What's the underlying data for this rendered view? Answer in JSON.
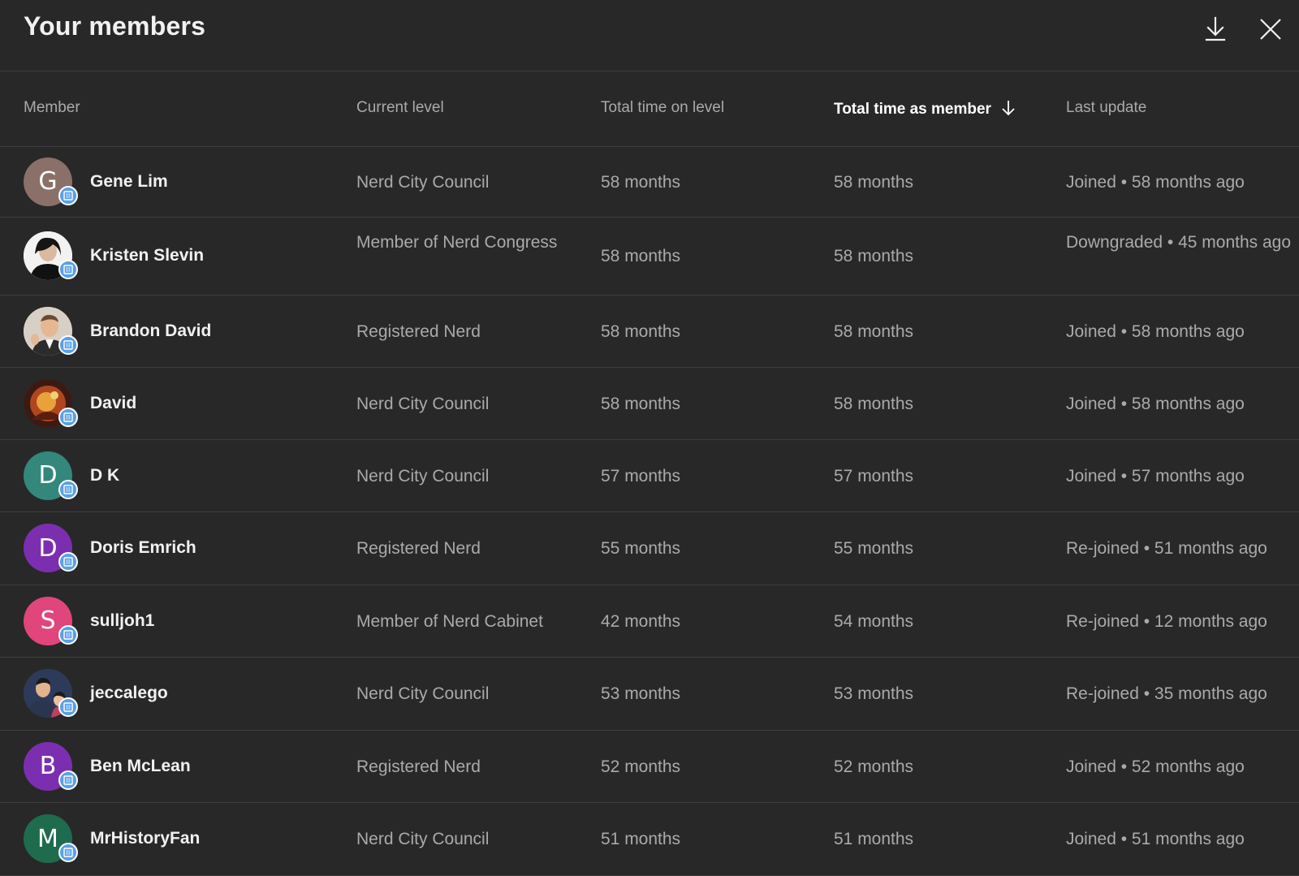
{
  "header": {
    "title": "Your members",
    "download_icon": "download-icon",
    "close_icon": "close-icon"
  },
  "columns": {
    "member": "Member",
    "current_level": "Current level",
    "time_on_level": "Total time on level",
    "time_as_member": "Total time as member",
    "last_update": "Last update",
    "sorted_by": "time_as_member",
    "sort_direction": "descending"
  },
  "colors": {
    "background": "#282828",
    "divider": "#3e3e3e",
    "badge": "#5aa0e6"
  },
  "members": [
    {
      "name": "Gene Lim",
      "avatar_letter": "G",
      "avatar_color": "#8a7068",
      "level": "Nerd City Council",
      "time_on_level": "58 months",
      "time_as_member": "58 months",
      "last_update": "Joined • 58 months ago"
    },
    {
      "name": "Kristen Slevin",
      "avatar_letter": "",
      "avatar_color": "#e9e9e9",
      "level": "Member of Nerd Congress",
      "time_on_level": "58 months",
      "time_as_member": "58 months",
      "last_update": "Downgraded • 45 months ago"
    },
    {
      "name": "Brandon David",
      "avatar_letter": "",
      "avatar_color": "#c9b8a4",
      "level": "Registered Nerd",
      "time_on_level": "58 months",
      "time_as_member": "58 months",
      "last_update": "Joined • 58 months ago"
    },
    {
      "name": "David",
      "avatar_letter": "",
      "avatar_color": "#7a2c1c",
      "level": "Nerd City Council",
      "time_on_level": "58 months",
      "time_as_member": "58 months",
      "last_update": "Joined • 58 months ago"
    },
    {
      "name": "D K",
      "avatar_letter": "D",
      "avatar_color": "#33877b",
      "level": "Nerd City Council",
      "time_on_level": "57 months",
      "time_as_member": "57 months",
      "last_update": "Joined • 57 months ago"
    },
    {
      "name": "Doris Emrich",
      "avatar_letter": "D",
      "avatar_color": "#7b2fb0",
      "level": "Registered Nerd",
      "time_on_level": "55 months",
      "time_as_member": "55 months",
      "last_update": "Re-joined • 51 months ago"
    },
    {
      "name": "sulljoh1",
      "avatar_letter": "S",
      "avatar_color": "#e0457b",
      "level": "Member of Nerd Cabinet",
      "time_on_level": "42 months",
      "time_as_member": "54 months",
      "last_update": "Re-joined • 12 months ago"
    },
    {
      "name": "jeccalego",
      "avatar_letter": "",
      "avatar_color": "#3d4a6b",
      "level": "Nerd City Council",
      "time_on_level": "53 months",
      "time_as_member": "53 months",
      "last_update": "Re-joined • 35 months ago"
    },
    {
      "name": "Ben McLean",
      "avatar_letter": "B",
      "avatar_color": "#7b2fb0",
      "level": "Registered Nerd",
      "time_on_level": "52 months",
      "time_as_member": "52 months",
      "last_update": "Joined • 52 months ago"
    },
    {
      "name": "MrHistoryFan",
      "avatar_letter": "M",
      "avatar_color": "#1f6b4e",
      "level": "Nerd City Council",
      "time_on_level": "51 months",
      "time_as_member": "51 months",
      "last_update": "Joined • 51 months ago"
    }
  ]
}
